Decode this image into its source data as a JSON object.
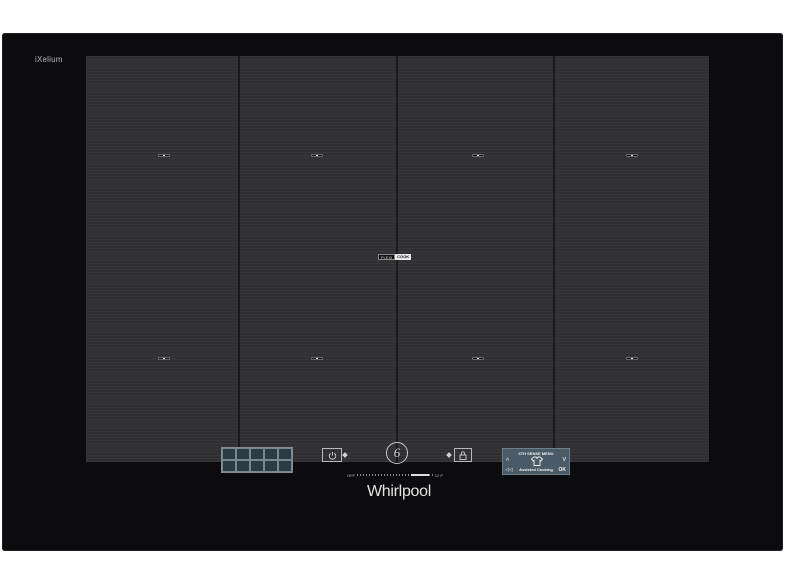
{
  "hob": {
    "series_logo": "iXelium",
    "zone_badge": {
      "left": "FLEXI",
      "right": "COOK"
    },
    "brand": "Whirlpool",
    "zone_columns": 4,
    "zone_markers": 8
  },
  "controls": {
    "power_icon": "power-icon",
    "sixth_sense_label": "6",
    "lock_icon": "lock-icon",
    "slider": {
      "min_label": "OFF",
      "max_label": "12 P"
    }
  },
  "display": {
    "title": "6TH SENSE MENU",
    "item": "Assisted Cooking",
    "up_icon": "^",
    "down_icon": "v",
    "back_icon": "◁◁",
    "ok_label": "OK",
    "item_icon": "shirt-icon"
  },
  "colors": {
    "panel": "#0c0c0e",
    "zones": "#303033",
    "display": "#4a5a66"
  }
}
